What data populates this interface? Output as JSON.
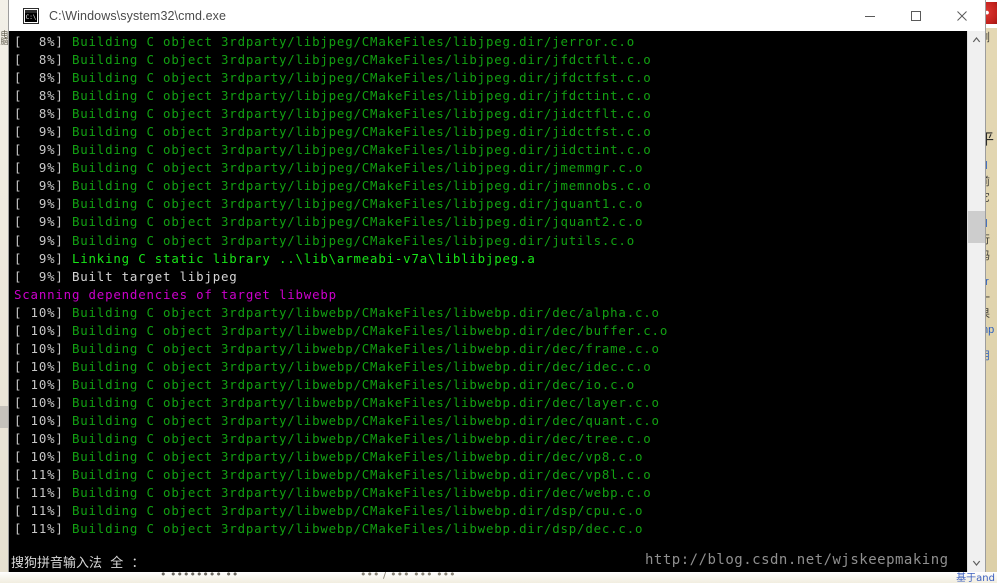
{
  "window": {
    "title": "C:\\Windows\\system32\\cmd.exe",
    "icon": "cmd-console-icon",
    "minimize_label": "—",
    "maximize_label": "□",
    "close_label": "✕"
  },
  "scrollbar": {
    "up_arrow": "▲",
    "down_arrow": "▼"
  },
  "terminal": {
    "background_color": "#000000",
    "colors": {
      "build_green": "#12a012",
      "link_bright_green": "#18e618",
      "built_white": "#d6d6d6",
      "scanning_magenta": "#cc00cc"
    },
    "lines": [
      {
        "style": "dim",
        "prefix": "[  8%] ",
        "text": "Building C object 3rdparty/libjpeg/CMakeFiles/libjpeg.dir/jerror.c.o"
      },
      {
        "style": "dim",
        "prefix": "[  8%] ",
        "text": "Building C object 3rdparty/libjpeg/CMakeFiles/libjpeg.dir/jfdctflt.c.o"
      },
      {
        "style": "dim",
        "prefix": "[  8%] ",
        "text": "Building C object 3rdparty/libjpeg/CMakeFiles/libjpeg.dir/jfdctfst.c.o"
      },
      {
        "style": "dim",
        "prefix": "[  8%] ",
        "text": "Building C object 3rdparty/libjpeg/CMakeFiles/libjpeg.dir/jfdctint.c.o"
      },
      {
        "style": "dim",
        "prefix": "[  8%] ",
        "text": "Building C object 3rdparty/libjpeg/CMakeFiles/libjpeg.dir/jidctflt.c.o"
      },
      {
        "style": "dim",
        "prefix": "[  9%] ",
        "text": "Building C object 3rdparty/libjpeg/CMakeFiles/libjpeg.dir/jidctfst.c.o"
      },
      {
        "style": "dim",
        "prefix": "[  9%] ",
        "text": "Building C object 3rdparty/libjpeg/CMakeFiles/libjpeg.dir/jidctint.c.o"
      },
      {
        "style": "dim",
        "prefix": "[  9%] ",
        "text": "Building C object 3rdparty/libjpeg/CMakeFiles/libjpeg.dir/jmemmgr.c.o"
      },
      {
        "style": "dim",
        "prefix": "[  9%] ",
        "text": "Building C object 3rdparty/libjpeg/CMakeFiles/libjpeg.dir/jmemnobs.c.o"
      },
      {
        "style": "dim",
        "prefix": "[  9%] ",
        "text": "Building C object 3rdparty/libjpeg/CMakeFiles/libjpeg.dir/jquant1.c.o"
      },
      {
        "style": "dim",
        "prefix": "[  9%] ",
        "text": "Building C object 3rdparty/libjpeg/CMakeFiles/libjpeg.dir/jquant2.c.o"
      },
      {
        "style": "dim",
        "prefix": "[  9%] ",
        "text": "Building C object 3rdparty/libjpeg/CMakeFiles/libjpeg.dir/jutils.c.o"
      },
      {
        "style": "bright",
        "prefix": "[  9%] ",
        "text": "Linking C static library ..\\lib\\armeabi-v7a\\liblibjpeg.a"
      },
      {
        "style": "white",
        "prefix": "[  9%] ",
        "text": "Built target libjpeg"
      },
      {
        "style": "magenta",
        "prefix": "",
        "text": "Scanning dependencies of target libwebp"
      },
      {
        "style": "dim",
        "prefix": "[ 10%] ",
        "text": "Building C object 3rdparty/libwebp/CMakeFiles/libwebp.dir/dec/alpha.c.o"
      },
      {
        "style": "dim",
        "prefix": "[ 10%] ",
        "text": "Building C object 3rdparty/libwebp/CMakeFiles/libwebp.dir/dec/buffer.c.o"
      },
      {
        "style": "dim",
        "prefix": "[ 10%] ",
        "text": "Building C object 3rdparty/libwebp/CMakeFiles/libwebp.dir/dec/frame.c.o"
      },
      {
        "style": "dim",
        "prefix": "[ 10%] ",
        "text": "Building C object 3rdparty/libwebp/CMakeFiles/libwebp.dir/dec/idec.c.o"
      },
      {
        "style": "dim",
        "prefix": "[ 10%] ",
        "text": "Building C object 3rdparty/libwebp/CMakeFiles/libwebp.dir/dec/io.c.o"
      },
      {
        "style": "dim",
        "prefix": "[ 10%] ",
        "text": "Building C object 3rdparty/libwebp/CMakeFiles/libwebp.dir/dec/layer.c.o"
      },
      {
        "style": "dim",
        "prefix": "[ 10%] ",
        "text": "Building C object 3rdparty/libwebp/CMakeFiles/libwebp.dir/dec/quant.c.o"
      },
      {
        "style": "dim",
        "prefix": "[ 10%] ",
        "text": "Building C object 3rdparty/libwebp/CMakeFiles/libwebp.dir/dec/tree.c.o"
      },
      {
        "style": "dim",
        "prefix": "[ 10%] ",
        "text": "Building C object 3rdparty/libwebp/CMakeFiles/libwebp.dir/dec/vp8.c.o"
      },
      {
        "style": "dim",
        "prefix": "[ 11%] ",
        "text": "Building C object 3rdparty/libwebp/CMakeFiles/libwebp.dir/dec/vp8l.c.o"
      },
      {
        "style": "dim",
        "prefix": "[ 11%] ",
        "text": "Building C object 3rdparty/libwebp/CMakeFiles/libwebp.dir/dec/webp.c.o"
      },
      {
        "style": "dim",
        "prefix": "[ 11%] ",
        "text": "Building C object 3rdparty/libwebp/CMakeFiles/libwebp.dir/dsp/cpu.c.o"
      },
      {
        "style": "dim",
        "prefix": "[ 11%] ",
        "text": "Building C object 3rdparty/libwebp/CMakeFiles/libwebp.dir/dsp/dec.c.o"
      }
    ]
  },
  "ime": {
    "text": "搜狗拼音输入法  全  ："
  },
  "watermark": {
    "text": "http://blog.csdn.net/wjskeepmaking"
  },
  "background": {
    "left_glyph": "电脑",
    "badge": "•",
    "right_lines": [
      {
        "text": "浏",
        "cls": "brow"
      },
      {
        "text": "",
        "cls": "bspace"
      },
      {
        "text": "",
        "cls": "bspace"
      },
      {
        "text": "",
        "cls": "bspace"
      },
      {
        "text": "",
        "cls": "bspace"
      },
      {
        "text": "",
        "cls": "bspace"
      },
      {
        "text": "",
        "cls": "bspace"
      },
      {
        "text": "",
        "cls": "bspace"
      },
      {
        "text": "l)",
        "cls": "brow blink"
      },
      {
        "text": "平",
        "cls": "brow bbig"
      },
      {
        "text": "",
        "cls": "bspace"
      },
      {
        "text": "al",
        "cls": "brow blink"
      },
      {
        "text": "前",
        "cls": "brow"
      },
      {
        "text": "它",
        "cls": "brow"
      },
      {
        "text": "",
        "cls": "bspace"
      },
      {
        "text": "al",
        "cls": "brow blink"
      },
      {
        "text": "行",
        "cls": "brow"
      },
      {
        "text": "吗",
        "cls": "brow"
      },
      {
        "text": "",
        "cls": "bspace"
      },
      {
        "text": "or",
        "cls": "brow blink"
      },
      {
        "text": "一",
        "cls": "brow"
      },
      {
        "text": "果",
        "cls": "brow"
      },
      {
        "text": "mp",
        "cls": "brow blink"
      },
      {
        "text": "",
        "cls": "bspace"
      },
      {
        "text": "用",
        "cls": "brow blink"
      }
    ]
  },
  "taskbar": {
    "left_text": "•  ••••••••  ••",
    "mid_text": "••• / ••• ••• •••",
    "right_text": "基于and"
  }
}
